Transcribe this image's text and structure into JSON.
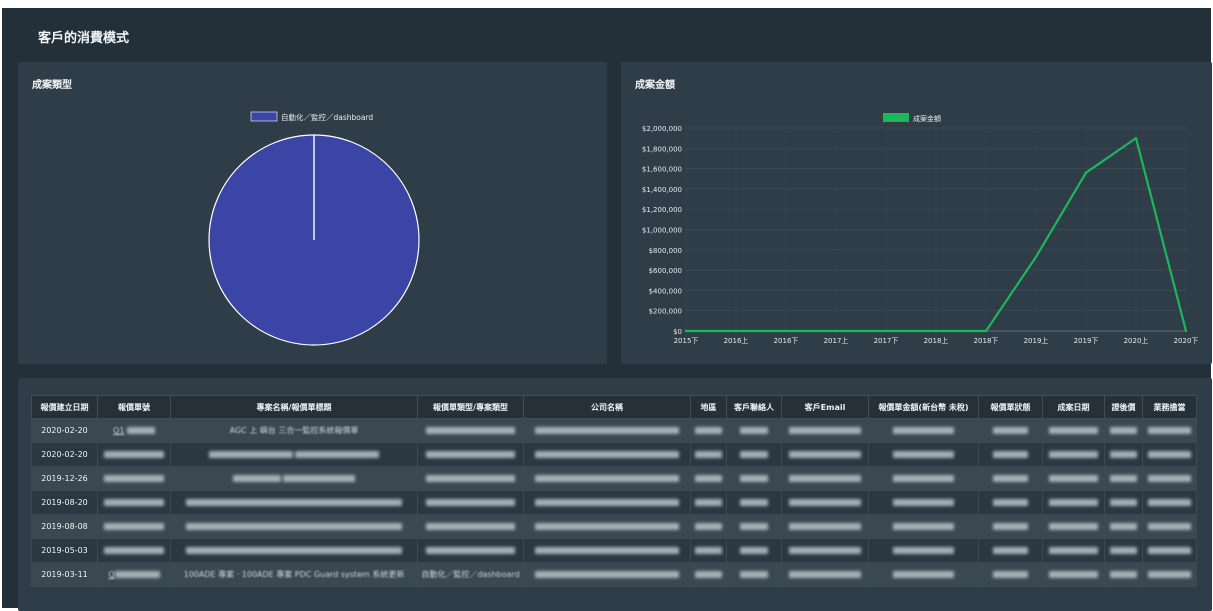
{
  "page": {
    "title": "客戶的消費模式"
  },
  "pie_panel": {
    "title": "成案類型"
  },
  "line_panel": {
    "title": "成案金額"
  },
  "chart_data": [
    {
      "type": "pie",
      "title": "成案類型",
      "legend": [
        "自動化／監控／dashboard"
      ],
      "series": [
        {
          "name": "自動化／監控／dashboard",
          "values": [
            100
          ]
        }
      ],
      "colors": [
        "#3a45a5"
      ]
    },
    {
      "type": "line",
      "title": "成案金額",
      "legend": [
        "成案金額"
      ],
      "categories": [
        "2015下",
        "2016上",
        "2016下",
        "2017上",
        "2017下",
        "2018上",
        "2018下",
        "2019上",
        "2019下",
        "2020上",
        "2020下"
      ],
      "series": [
        {
          "name": "成案金額",
          "values": [
            0,
            0,
            0,
            0,
            0,
            0,
            0,
            730000,
            1560000,
            1900000,
            0
          ]
        }
      ],
      "yticks": [
        "$0",
        "$200,000",
        "$400,000",
        "$600,000",
        "$800,000",
        "$1,000,000",
        "$1,200,000",
        "$1,400,000",
        "$1,600,000",
        "$1,800,000",
        "$2,000,000"
      ],
      "ylim": [
        0,
        2000000
      ],
      "grid": true,
      "legend_position": "top-center",
      "colors": [
        "#1db65c"
      ]
    }
  ],
  "table": {
    "headers": [
      "報價建立日期",
      "報價單號",
      "專案名稱/報價單標題",
      "報價單類型/專案類型",
      "公司名稱",
      "地區",
      "客戶聯絡人",
      "客戶Email",
      "報價單金額(新台幣 未稅)",
      "報價單狀態",
      "成案日期",
      "證後價",
      "業務擔當"
    ],
    "dates": [
      "2020-02-20",
      "2020-02-20",
      "2019-12-26",
      "2019-08-20",
      "2019-08-08",
      "2019-05-03",
      "2019-03-11"
    ],
    "row1": {
      "code": "Q1",
      "project": "AGC 上 嶼台 三合一監控系統報價單"
    },
    "row7": {
      "code": "Q",
      "project": "100ADE 專案 · 100ADE 專案 PDC Guard system 系統更新",
      "type": "自動化／監控／dashboard"
    }
  }
}
